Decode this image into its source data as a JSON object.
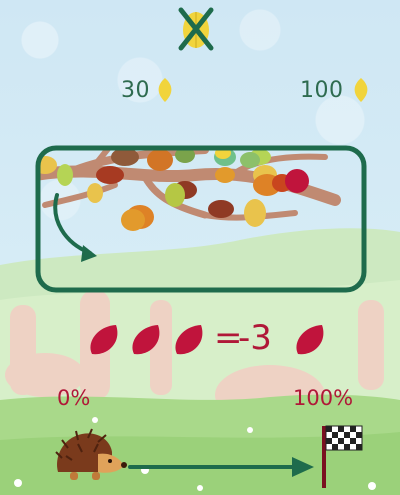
{
  "hud": {
    "close_icon": "x-over-leaf-icon",
    "left_counter": "30",
    "right_counter": "100",
    "counter_icon": "yellow-leaf-icon"
  },
  "puzzle": {
    "equation_sign": "=",
    "equation_value": "-3",
    "leaf_icon": "red-leaf-icon"
  },
  "progress": {
    "start_label": "0%",
    "end_label": "100%",
    "start_icon": "hedgehog-icon",
    "goal_icon": "checkered-flag-icon",
    "value": 0
  },
  "colors": {
    "dark_green": "#1e6b4c",
    "red": "#c0143c",
    "leaf_yellow": "#f1d43c"
  }
}
